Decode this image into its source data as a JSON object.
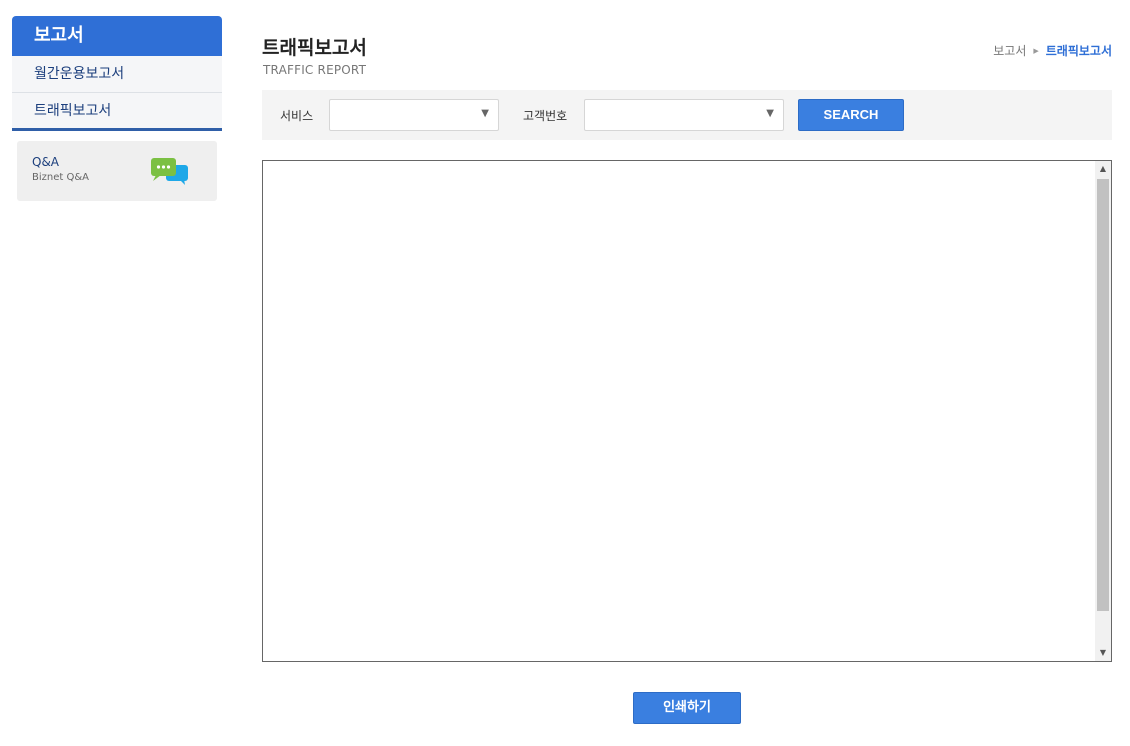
{
  "sidebar": {
    "title": "보고서",
    "items": [
      {
        "label": "월간운용보고서"
      },
      {
        "label": "트래픽보고서"
      }
    ],
    "qa": {
      "title": "Q&A",
      "subtitle": "Biznet Q&A",
      "icon": "chat-bubbles-icon"
    }
  },
  "header": {
    "title": "트래픽보고서",
    "subtitle": "TRAFFIC REPORT",
    "breadcrumb": {
      "parent": "보고서",
      "current": "트래픽보고서"
    }
  },
  "search": {
    "service_label": "서비스",
    "service_value": "",
    "customer_label": "고객번호",
    "customer_value": "",
    "button_label": "SEARCH"
  },
  "actions": {
    "print_label": "인쇄하기"
  },
  "colors": {
    "accent": "#2f6fd6",
    "button": "#3a7fe0",
    "navy_text": "#1c3f7d"
  }
}
